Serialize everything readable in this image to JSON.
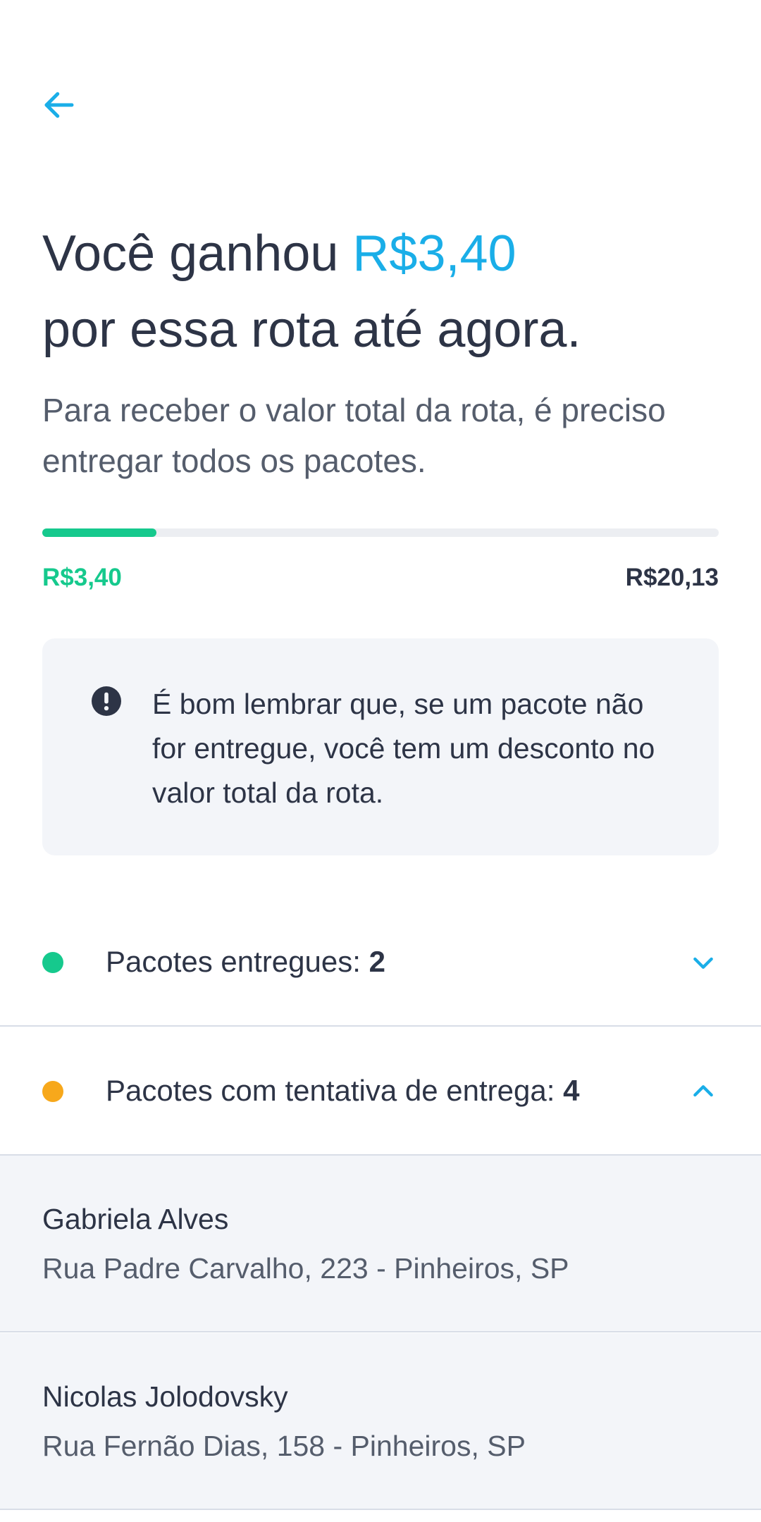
{
  "header": {
    "back_icon": "arrow-left-icon"
  },
  "summary": {
    "title_prefix": "Você ganhou ",
    "title_amount": "R$3,40",
    "title_suffix": "por essa rota até agora.",
    "subtitle": "Para receber o valor total da rota, é preciso entregar todos os pacotes."
  },
  "progress": {
    "earned": "R$3,40",
    "total": "R$20,13",
    "fraction": 0.169,
    "fill_color": "#16c98d"
  },
  "notice": {
    "icon": "exclamation-circle-icon",
    "text": "É bom lembrar que, se um pacote não for entregue, você tem um desconto no valor total da rota."
  },
  "groups": [
    {
      "label": "Pacotes entregues: ",
      "count": "2",
      "color": "#16c98d",
      "expanded": false,
      "icon": "chevron-down-icon"
    },
    {
      "label": "Pacotes com tentativa de entrega: ",
      "count": "4",
      "color": "#f7a81b",
      "expanded": true,
      "icon": "chevron-up-icon"
    }
  ],
  "attempted_packages": [
    {
      "name": "Gabriela Alves",
      "address": "Rua Padre Carvalho, 223 - Pinheiros, SP"
    },
    {
      "name": "Nicolas Jolodovsky",
      "address": "Rua Fernão Dias, 158 - Pinheiros, SP"
    }
  ],
  "colors": {
    "accent": "#1aaee8",
    "success": "#16c98d",
    "warning": "#f7a81b",
    "text": "#2d3446"
  }
}
